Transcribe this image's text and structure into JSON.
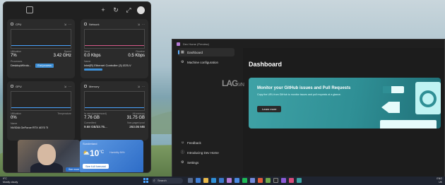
{
  "widgets": {
    "cpu": {
      "title": "CPU",
      "label_left": "Utilization",
      "label_right": "Speed",
      "value_left": "7%",
      "value_right": "3.42 GHz",
      "sub_label": "Processes",
      "sub_value": "DesktopWindo...",
      "action": "End process"
    },
    "network": {
      "title": "Network",
      "label_left": "Send",
      "label_right": "Receive",
      "value_left": "0.0 Kbps",
      "value_right": "0.5 Kbps",
      "sub_label": "Name",
      "sub_value": "Intel(R) Ethernet Controller (3) I225-V"
    },
    "gpu": {
      "title": "GPU",
      "label_left": "Utilization",
      "label_right": "Temperature",
      "value_left": "0%",
      "value_right": "",
      "sub_label": "Name",
      "sub_value": "NVIDIA GeForce RTX 4070 Ti"
    },
    "memory": {
      "title": "Memory",
      "label_left": "In use (compressed)",
      "label_right": "All memory",
      "value_left": "7.76 GB",
      "value_right": "31.75 GB",
      "sub_label_left": "Committed",
      "sub_label_right": "Non-paged pool",
      "sub_value_left": "9.68 GB/33.75...",
      "sub_value_right": "263.05 MB"
    },
    "weather": {
      "location": "Sunderland",
      "temp": "10",
      "unit": "°C",
      "humidity": "Humidity 84%",
      "forecast_button": "See full forecast"
    },
    "photo": {
      "see_more": "See more"
    }
  },
  "devhome": {
    "window_title": "Dev Home (Preview)",
    "nav": [
      {
        "label": "Dashboard",
        "icon": "dashboard-icon"
      },
      {
        "label": "Machine configuration",
        "icon": "machine-config-icon"
      }
    ],
    "nav_bottom": [
      {
        "label": "Feedback",
        "icon": "feedback-icon"
      },
      {
        "label": "Introducing Dev Home",
        "icon": "info-icon"
      },
      {
        "label": "Settings",
        "icon": "gear-icon"
      }
    ],
    "page_title": "Dashboard",
    "banner": {
      "title": "Monitor your GitHub issues and Pull Requests",
      "description": "Copy the URL from GitHub to monitor issues and pull requests at a glance.",
      "button": "Learn more"
    }
  },
  "watermark": {
    "text": "LAG",
    "suffix": ".VN"
  },
  "taskbar": {
    "weather_temp": "9°C",
    "weather_desc": "Mostly cloudy",
    "search_placeholder": "Search",
    "tray_lang": "ENG",
    "tray_region": "UK"
  }
}
